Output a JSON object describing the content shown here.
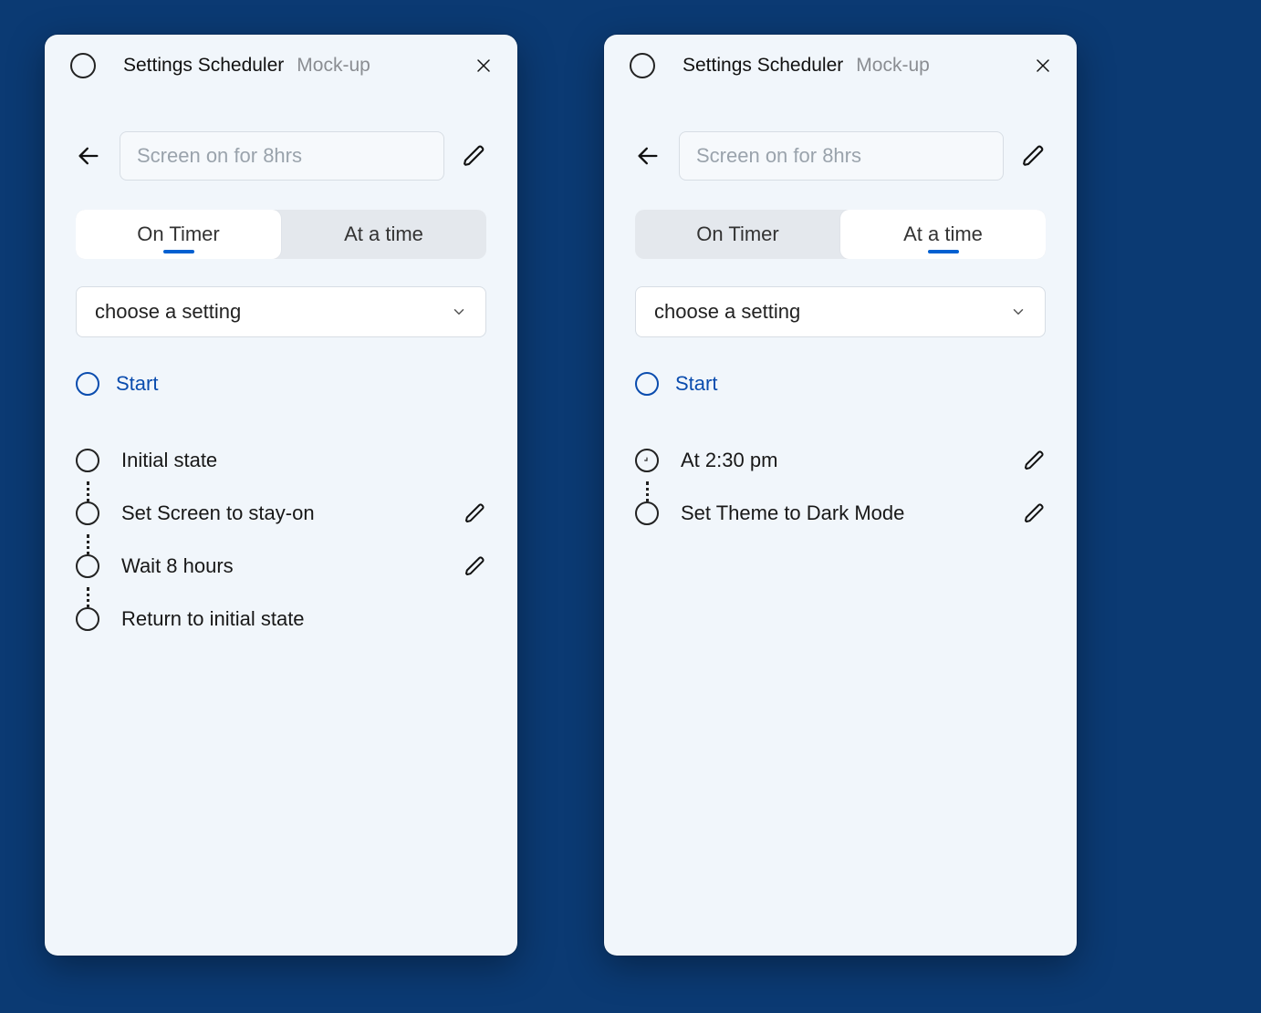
{
  "panels": [
    {
      "titlebar": {
        "title": "Settings Scheduler",
        "subtitle": "Mock-up"
      },
      "name_placeholder": "Screen on for 8hrs",
      "tabs": {
        "a": "On Timer",
        "b": "At a time",
        "active": "a"
      },
      "dropdown": {
        "label": "choose a setting"
      },
      "start_label": "Start",
      "steps": [
        {
          "label": "Initial state",
          "icon": "circle",
          "editable": false,
          "connector": true
        },
        {
          "label": "Set Screen to stay-on",
          "icon": "circle",
          "editable": true,
          "connector": true
        },
        {
          "label": "Wait 8 hours",
          "icon": "circle",
          "editable": true,
          "connector": true
        },
        {
          "label": "Return to initial state",
          "icon": "circle",
          "editable": false,
          "connector": false
        }
      ]
    },
    {
      "titlebar": {
        "title": "Settings Scheduler",
        "subtitle": "Mock-up"
      },
      "name_placeholder": "Screen on for 8hrs",
      "tabs": {
        "a": "On Timer",
        "b": "At a time",
        "active": "b"
      },
      "dropdown": {
        "label": "choose a setting"
      },
      "start_label": "Start",
      "steps": [
        {
          "label": "At 2:30 pm",
          "icon": "clock",
          "editable": true,
          "connector": true
        },
        {
          "label": "Set Theme to Dark Mode",
          "icon": "circle",
          "editable": true,
          "connector": false
        }
      ]
    }
  ]
}
